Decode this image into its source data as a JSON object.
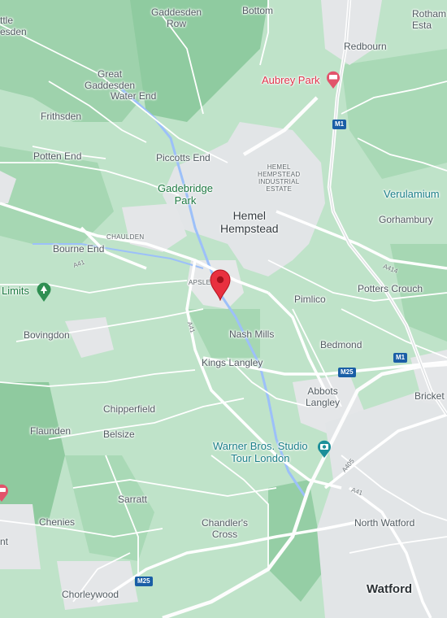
{
  "map": {
    "places": {
      "little_gaddesden": "ttle\nesden",
      "gaddesden_row": "Gaddesden\nRow",
      "howley_bottom": "Bottom",
      "rothamsted": "Rotham\nEsta",
      "redbourn": "Redbourn",
      "aubrey_park": "Aubrey Park",
      "great_gaddesden": "Great\nGaddesden",
      "water_end": "Water End",
      "frithsden": "Frithsden",
      "potten_end": "Potten End",
      "piccotts_end": "Piccotts End",
      "hemel_industrial": "HEMEL\nHEMPSTEAD\nINDUSTRIAL\nESTATE",
      "gadebridge_park": "Gadebridge\nPark",
      "verulamium": "Verulamium",
      "hemel_hempstead": "Hemel\nHempstead",
      "gorhambury": "Gorhambury",
      "chaulden": "CHAULDEN",
      "bourne_end": "Bourne End",
      "apsley": "APSLEY",
      "limits": "Limits",
      "pimlico": "Pimlico",
      "potters_crouch": "Potters Crouch",
      "bovingdon": "Bovingdon",
      "nash_mills": "Nash Mills",
      "bedmond": "Bedmond",
      "kings_langley": "Kings Langley",
      "abbots_langley": "Abbots\nLangley",
      "bricket": "Bricket",
      "chipperfield": "Chipperfield",
      "flaunden": "Flaunden",
      "belsize": "Belsize",
      "warner_bros": "Warner Bros. Studio\nTour London",
      "sarratt": "Sarratt",
      "chenies": "Chenies",
      "north_watford": "North Watford",
      "chandlers_cross": "Chandler's\nCross",
      "nt": "nt",
      "chorleywood": "Chorleywood",
      "watford": "Watford"
    },
    "roads": {
      "m1_north": "M1",
      "m1_south": "M1",
      "m25_east": "M25",
      "m25_west": "M25",
      "a41_west": "A41",
      "a41_mid": "A41",
      "a41_south": "A41",
      "a414": "A414",
      "a405": "A405"
    },
    "colors": {
      "land": "#bfe3c9",
      "forest": "#9fd4ae",
      "urban": "#e3e6e8",
      "road": "#ffffff",
      "water": "#9cc0f9",
      "motorway_shield": "#1a5ea6",
      "pin": "#e8303f"
    },
    "icons": {
      "aubrey_park_icon": "hotel-icon",
      "warner_icon": "camera-icon",
      "limits_icon": "park-pin-icon",
      "west_edge_icon": "hotel-icon",
      "selected_pin": "location-pin-icon"
    }
  }
}
